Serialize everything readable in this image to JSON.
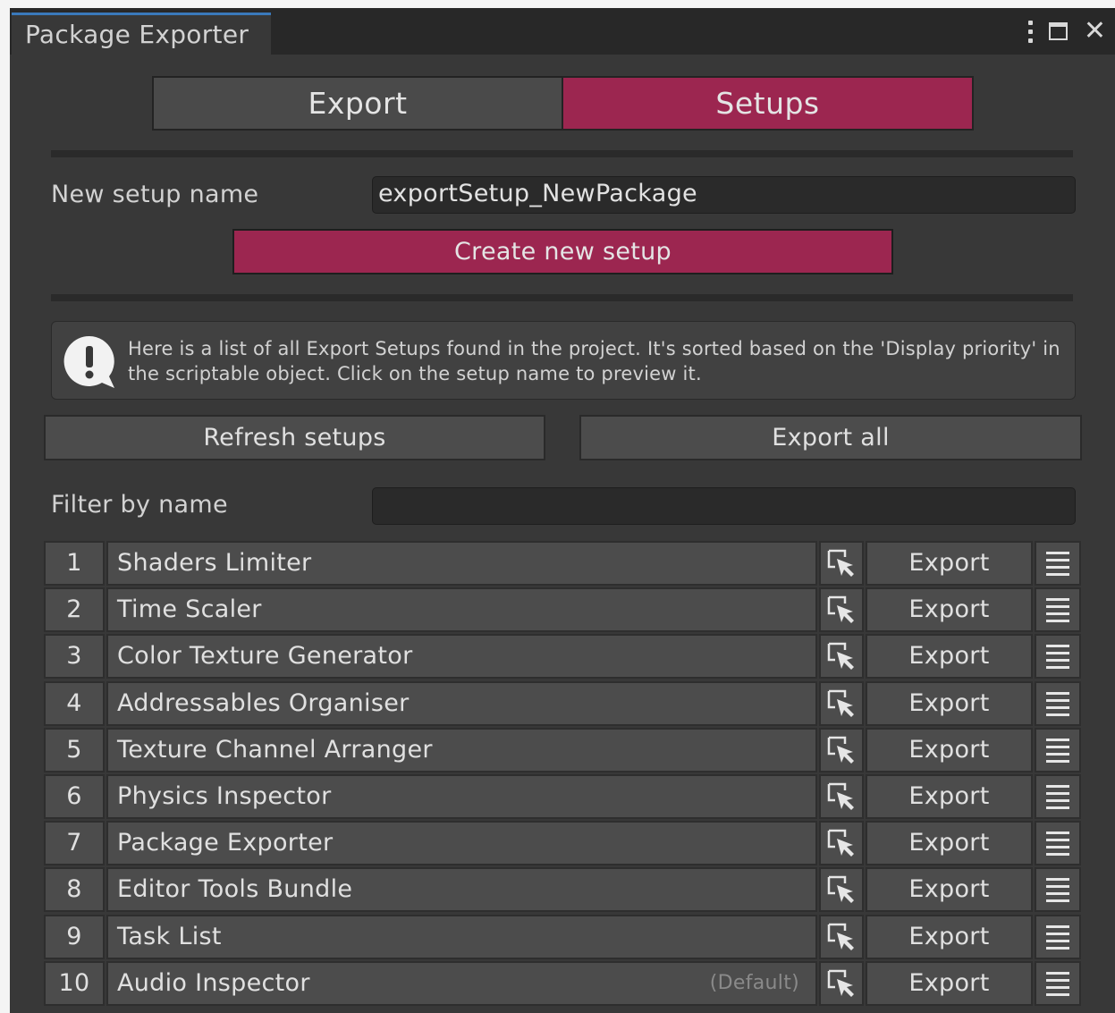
{
  "window": {
    "title": "Package Exporter",
    "icons": [
      "kebab-menu-icon",
      "maximize-icon",
      "close-icon"
    ]
  },
  "mode_tabs": {
    "export_label": "Export",
    "setups_label": "Setups",
    "selected": "Setups"
  },
  "new_setup": {
    "label": "New setup name",
    "value": "exportSetup_NewPackage",
    "create_label": "Create new setup"
  },
  "info": {
    "icon": "info-exclamation-icon",
    "text": "Here is a list of all Export Setups found in the project. It's sorted based on the 'Display priority' in the scriptable object. Click on the setup name to preview it."
  },
  "actions": {
    "refresh_label": "Refresh setups",
    "export_all_label": "Export all"
  },
  "filter": {
    "label": "Filter by name",
    "value": ""
  },
  "setups": [
    {
      "index": "1",
      "name": "Shaders Limiter",
      "tag": "",
      "export_label": "Export"
    },
    {
      "index": "2",
      "name": "Time Scaler",
      "tag": "",
      "export_label": "Export"
    },
    {
      "index": "3",
      "name": "Color Texture Generator",
      "tag": "",
      "export_label": "Export"
    },
    {
      "index": "4",
      "name": "Addressables Organiser",
      "tag": "",
      "export_label": "Export"
    },
    {
      "index": "5",
      "name": "Texture Channel Arranger",
      "tag": "",
      "export_label": "Export"
    },
    {
      "index": "6",
      "name": "Physics Inspector",
      "tag": "",
      "export_label": "Export"
    },
    {
      "index": "7",
      "name": "Package Exporter",
      "tag": "",
      "export_label": "Export"
    },
    {
      "index": "8",
      "name": "Editor Tools Bundle",
      "tag": "",
      "export_label": "Export"
    },
    {
      "index": "9",
      "name": "Task List",
      "tag": "",
      "export_label": "Export"
    },
    {
      "index": "10",
      "name": "Audio Inspector",
      "tag": "(Default)",
      "export_label": "Export"
    }
  ],
  "colors": {
    "accent": "#9c2650",
    "panel": "#383838",
    "button": "#4c4c4c",
    "field": "#2a2a2a",
    "tab_highlight": "#3a79bb"
  }
}
